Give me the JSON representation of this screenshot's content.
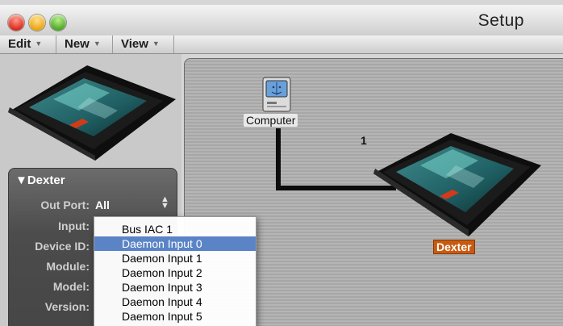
{
  "window": {
    "title": "Setup"
  },
  "menubar": {
    "items": [
      {
        "label": "Edit"
      },
      {
        "label": "New"
      },
      {
        "label": "View"
      }
    ]
  },
  "inspector": {
    "title": "▼Dexter",
    "fields": [
      {
        "label": "Out Port:",
        "value": "All"
      },
      {
        "label": "Input:"
      },
      {
        "label": "Device ID:"
      },
      {
        "label": "Module:"
      },
      {
        "label": "Model:"
      },
      {
        "label": "Version:"
      }
    ]
  },
  "canvas": {
    "computer_label": "Computer",
    "cable_number": "1",
    "device_label": "Dexter"
  },
  "dropdown": {
    "options": [
      "Bus IAC 1",
      "Daemon Input 0",
      "Daemon Input 1",
      "Daemon Input 2",
      "Daemon Input 3",
      "Daemon Input 4",
      "Daemon Input 5"
    ],
    "selected_index": 1
  },
  "colors": {
    "selection": "#5a84c6",
    "device_label_bg": "#c85a10"
  },
  "icons": [
    "computer-icon",
    "dexter-device-icon"
  ]
}
